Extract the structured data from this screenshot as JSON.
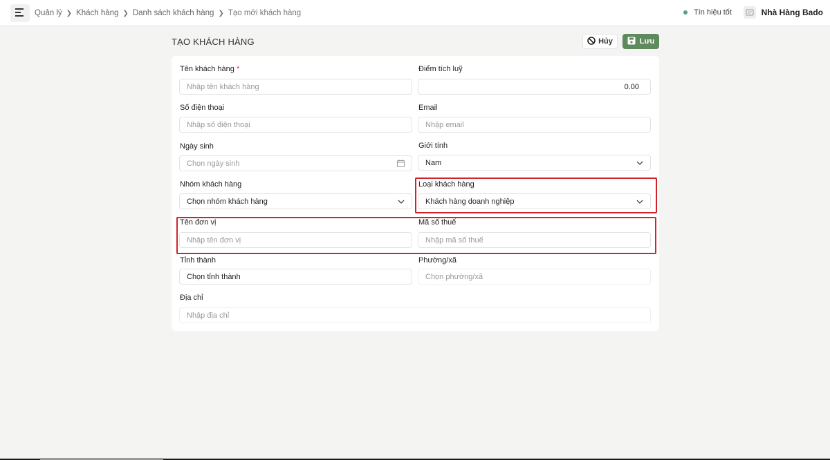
{
  "breadcrumb": {
    "items": [
      "Quản lý",
      "Khách hàng",
      "Danh sách khách hàng"
    ],
    "current": "Tạo mới khách hàng"
  },
  "status": {
    "label": "Tín hiệu tốt",
    "color": "#4fa37b"
  },
  "store": {
    "name": "Nhà Hàng Bado"
  },
  "page": {
    "title": "TẠO KHÁCH HÀNG"
  },
  "actions": {
    "cancel": "Hủy",
    "save": "Lưu",
    "save_color": "#5f8a5e"
  },
  "form": {
    "customer_name": {
      "label": "Tên khách hàng",
      "required": "*",
      "placeholder": "Nhập tên khách hàng"
    },
    "points": {
      "label": "Điểm tích luỹ",
      "value": "0.00"
    },
    "phone": {
      "label": "Số điện thoại",
      "placeholder": "Nhập số điện thoại"
    },
    "email": {
      "label": "Email",
      "placeholder": "Nhập email"
    },
    "birthday": {
      "label": "Ngày sinh",
      "placeholder": "Chọn ngày sinh"
    },
    "gender": {
      "label": "Giới tính",
      "value": "Nam"
    },
    "customer_group": {
      "label": "Nhóm khách hàng",
      "value": "Chọn nhóm khách hàng"
    },
    "customer_type": {
      "label": "Loại khách hàng",
      "value": "Khách hàng doanh nghiệp"
    },
    "company_name": {
      "label": "Tên đơn vị",
      "placeholder": "Nhập tên đơn vị"
    },
    "tax_code": {
      "label": "Mã số thuế",
      "placeholder": "Nhập mã số thuế"
    },
    "province": {
      "label": "Tỉnh thành",
      "value": "Chọn tỉnh thành"
    },
    "ward": {
      "label": "Phường/xã",
      "placeholder": "Chọn phường/xã"
    },
    "address": {
      "label": "Địa chỉ",
      "placeholder": "Nhập địa chỉ"
    }
  },
  "highlight_color": "#d2232a"
}
